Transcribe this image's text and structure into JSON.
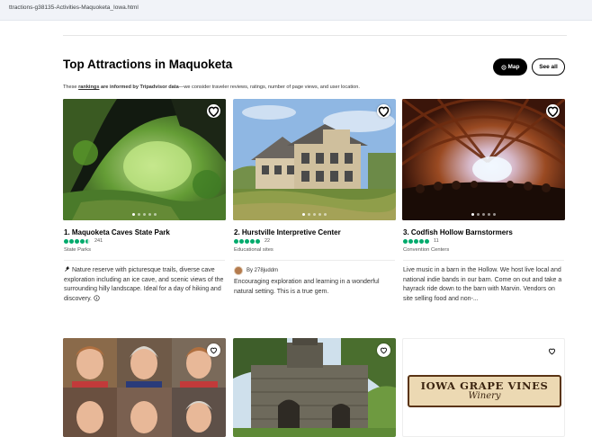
{
  "browser": {
    "url": "ttractions-g38135-Activities-Maquoketa_Iowa.html"
  },
  "header": {
    "title": "Top Attractions in Maquoketa",
    "map_label": "Map",
    "see_all_label": "See all"
  },
  "disclaimer": {
    "prefix": "These ",
    "link": "rankings",
    "middle": " are informed by Tripadvisor data",
    "suffix": "—we consider traveler reviews, ratings, number of page views, and user location."
  },
  "cards": [
    {
      "title": "1. Maquoketa Caves State Park",
      "rating": 4.5,
      "review_count": "241",
      "category": "State Parks",
      "description": "Nature reserve with picturesque trails, diverse cave exploration including an ice cave, and scenic views of the surrounding hilly landscape. Ideal for a day of hiking and discovery.",
      "image_icon": "cave-photo"
    },
    {
      "title": "2. Hurstville Interpretive Center",
      "rating": 5,
      "review_count": "22",
      "category": "Educational sites",
      "author": "By 278juddm",
      "description": "Encouraging exploration and learning in a wonderful natural setting. This is a true gem.",
      "image_icon": "building-photo"
    },
    {
      "title": "3. Codfish Hollow Barnstormers",
      "rating": 5,
      "review_count": "11",
      "category": "Convention Centers",
      "description": "Live music in a barn in the Hollow. We host live local and national indie bands in our barn. Come on out and take a hayrack ride down to the barn with Marvin. Vendors on site selling food and non-...",
      "image_icon": "concert-photo"
    }
  ],
  "bottom_cards": [
    {
      "image_icon": "portraits-photo"
    },
    {
      "image_icon": "lime-kiln-photo"
    },
    {
      "logo_line1": "IOWA GRAPE VINES",
      "logo_line2": "Winery"
    }
  ],
  "colors": {
    "rating_green": "#00aa6c",
    "button_black": "#000000"
  }
}
